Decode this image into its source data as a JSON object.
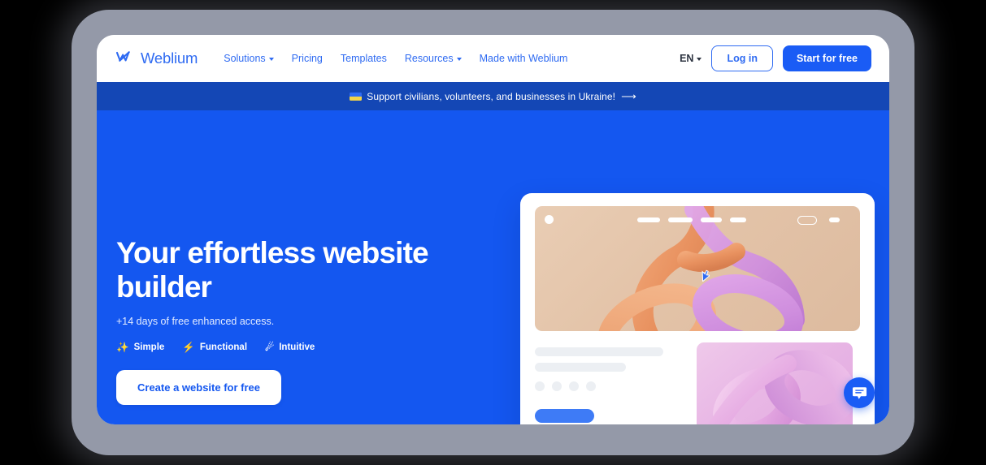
{
  "nav": {
    "brand": "Weblium",
    "brand_icon": "weblium-logo-mark",
    "menu": [
      {
        "label": "Solutions",
        "has_caret": true
      },
      {
        "label": "Pricing",
        "has_caret": false
      },
      {
        "label": "Templates",
        "has_caret": false
      },
      {
        "label": "Resources",
        "has_caret": true
      },
      {
        "label": "Made with Weblium",
        "has_caret": false
      }
    ],
    "language": "EN",
    "login_label": "Log in",
    "start_label": "Start for free"
  },
  "banner": {
    "icon": "ukraine-flag-icon",
    "text": "Support civilians, volunteers, and businesses in Ukraine!",
    "arrow": "⟶"
  },
  "hero": {
    "title": "Your effortless website builder",
    "subtitle": "+14 days of free enhanced access.",
    "badges": [
      {
        "icon": "✨",
        "icon_name": "sparkles-icon",
        "label": "Simple"
      },
      {
        "icon": "⚡",
        "icon_name": "lightning-bolt-icon",
        "label": "Functional"
      },
      {
        "icon": "☄",
        "icon_name": "comet-icon",
        "label": "Intuitive"
      }
    ],
    "cta_label": "Create a website for free"
  },
  "mockup": {
    "nav_placeholders": 4,
    "dots": 4,
    "text_lines": 2
  },
  "chat": {
    "icon": "chat-bubble-icon"
  },
  "colors": {
    "brand_blue": "#2f6bf2",
    "hero_blue": "#1457f0",
    "banner_blue": "#1447b5",
    "button_blue": "#1a5cf5",
    "frame_gray": "#9499a8",
    "page_white": "#ffffff"
  }
}
